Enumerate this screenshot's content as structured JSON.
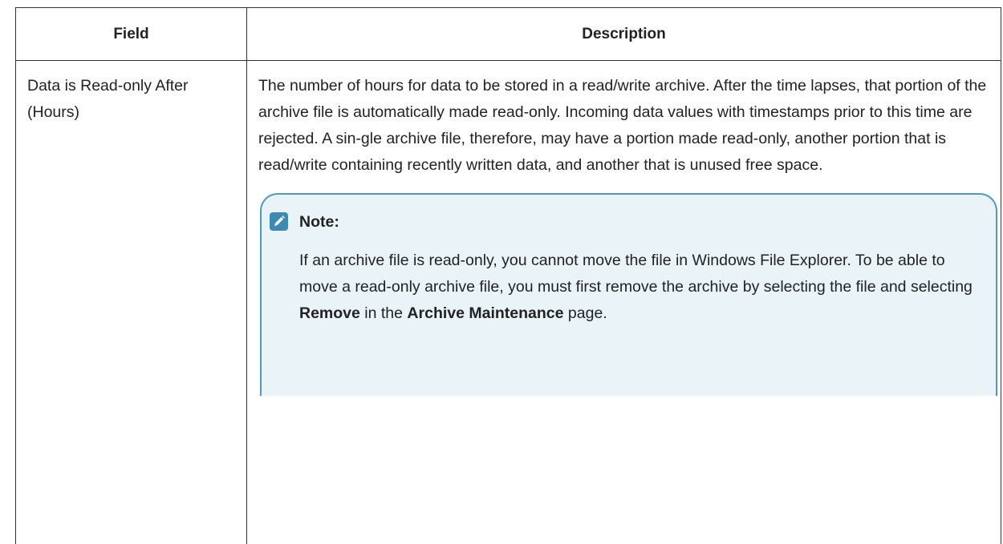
{
  "table": {
    "headers": {
      "field": "Field",
      "description": "Description"
    },
    "row": {
      "field": "Data is Read-only After (Hours)",
      "description": "The number of hours for data to be stored in a read/write archive. After the time lapses, that portion of the archive file is automatically made read-only. Incoming data values with timestamps prior to this time are rejected. A sin-gle archive file, therefore, may have a portion made read-only, another portion that is read/write containing recently written data, and another that is unused free space."
    }
  },
  "note": {
    "icon": "pencil-note-icon",
    "title": "Note:",
    "text_part1": "If an archive file is read-only, you cannot move the file in Windows File Explorer. To be able to move a read-only archive file, you must first remove the archive by selecting the file and selecting ",
    "bold1": "Remove",
    "text_part2": " in the ",
    "bold2": "Archive Maintenance",
    "text_part3": " page."
  },
  "colors": {
    "note_background": "#eaf4f8",
    "note_border": "#4a9bc2",
    "note_icon": "#3b8ab3",
    "table_border": "#333333"
  }
}
